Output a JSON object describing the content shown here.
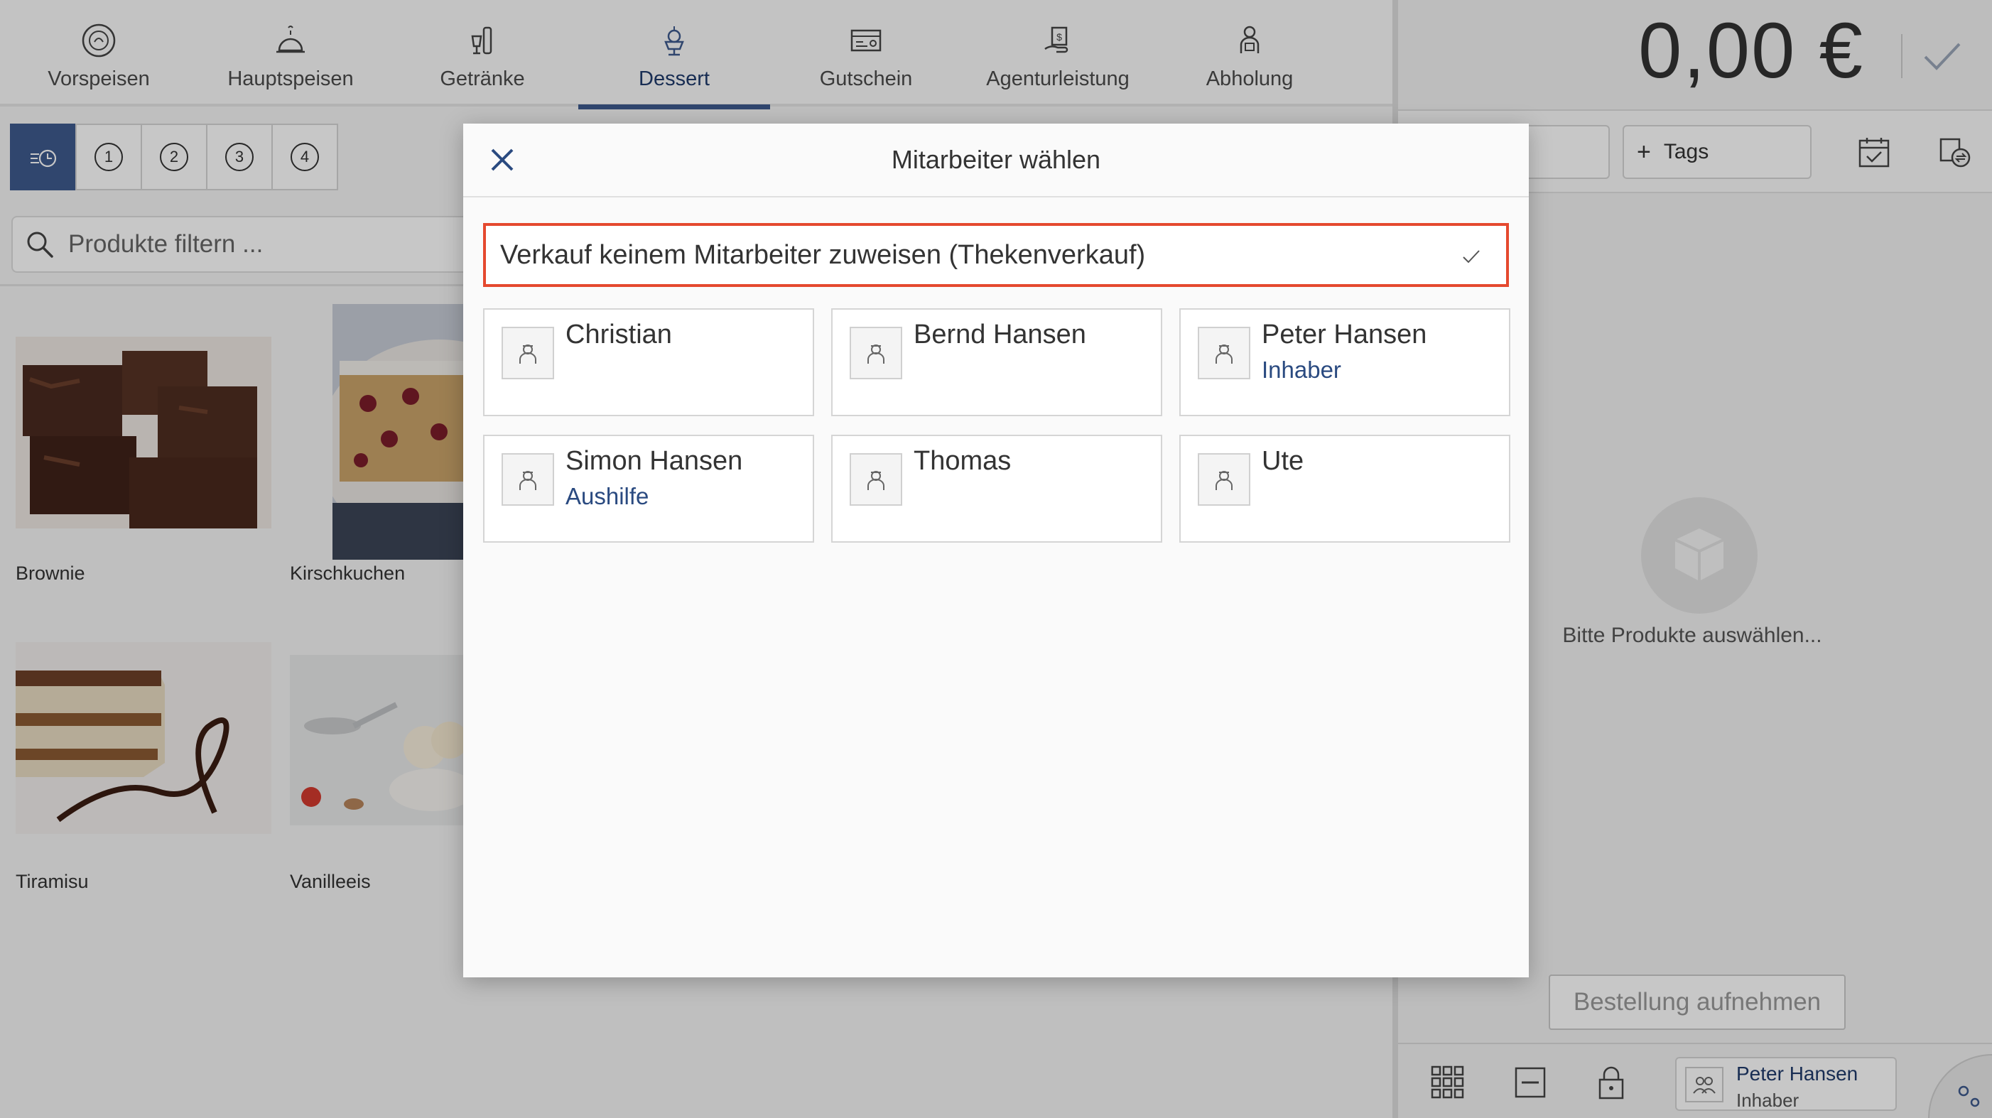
{
  "categories": [
    {
      "label": "Vorspeisen",
      "icon": "starter-icon"
    },
    {
      "label": "Hauptspeisen",
      "icon": "cloche-icon"
    },
    {
      "label": "Getränke",
      "icon": "drinks-icon"
    },
    {
      "label": "Dessert",
      "icon": "dessert-icon",
      "active": true
    },
    {
      "label": "Gutschein",
      "icon": "voucher-icon"
    },
    {
      "label": "Agenturleistung",
      "icon": "agency-icon"
    },
    {
      "label": "Abholung",
      "icon": "pickup-icon"
    }
  ],
  "order_tabs": [
    "1",
    "2",
    "3",
    "4"
  ],
  "filter": {
    "placeholder": "Produkte filtern ..."
  },
  "products": [
    {
      "name": "Brownie"
    },
    {
      "name": "Kirschkuchen"
    },
    {
      "name": "Tiramisu"
    },
    {
      "name": "Vanilleeis"
    }
  ],
  "cart": {
    "total": "0,00 €",
    "tags_label": "Tags",
    "tags_plus": "+",
    "empty_text": "Bitte Produkte auswählen...",
    "order_button": "Bestellung aufnehmen",
    "current_user": {
      "name": "Peter Hansen",
      "role": "Inhaber"
    }
  },
  "modal": {
    "title": "Mitarbeiter wählen",
    "no_assign_label": "Verkauf keinem Mitarbeiter zuweisen (Thekenverkauf)",
    "employees": [
      {
        "name": "Christian",
        "role": ""
      },
      {
        "name": "Bernd Hansen",
        "role": ""
      },
      {
        "name": "Peter Hansen",
        "role": "Inhaber"
      },
      {
        "name": "Simon Hansen",
        "role": "Aushilfe"
      },
      {
        "name": "Thomas",
        "role": ""
      },
      {
        "name": "Ute",
        "role": ""
      }
    ]
  },
  "colors": {
    "accent": "#3e5a8d",
    "selected_border": "#e5492f",
    "role_text": "#2a4a80"
  }
}
